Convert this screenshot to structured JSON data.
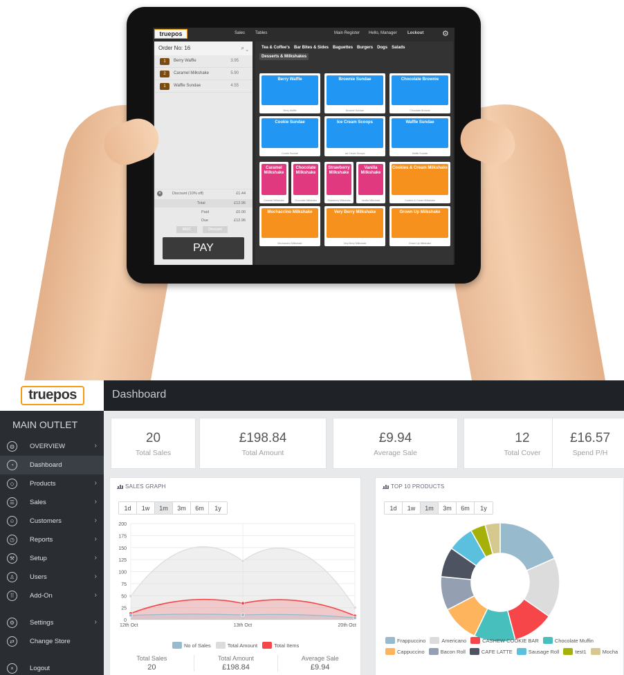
{
  "tablet": {
    "brand": "truepos",
    "top_nav": {
      "sales": "Sales",
      "tables": "Tables",
      "register": "Main Register",
      "user": "Hello, Manager",
      "lockout": "Lockout"
    },
    "order_title": "Order No: 16",
    "order_lines": [
      {
        "qty": "1",
        "name": "Berry Waffle",
        "price": "3.95"
      },
      {
        "qty": "2",
        "name": "Caramel Milkshake",
        "price": "5.90"
      },
      {
        "qty": "1",
        "name": "Waffle Sundae",
        "price": "4.55"
      }
    ],
    "discount_label": "Discount (10% off)",
    "discount_value": "£1.44",
    "total_label": "Total",
    "total_value": "£12.96",
    "paid_label": "Paid",
    "paid_value": "£0.00",
    "due_label": "Due",
    "due_value": "£12.96",
    "misc_label": "MISC",
    "discount_btn": "Discount",
    "pay_label": "PAY",
    "categories": [
      "Tea & Coffee's",
      "Bar Bites & Sides",
      "Baguettes",
      "Burgers",
      "Dogs",
      "Salads",
      "Desserts & Milkshakes"
    ],
    "tiles": [
      {
        "name": "Berry Waffle",
        "sub": "Berry Waffle",
        "color": "blue"
      },
      {
        "name": "Brownie Sundae",
        "sub": "Brownie Sundae",
        "color": "blue"
      },
      {
        "name": "Chocolate Brownie",
        "sub": "Chocolate Brownie",
        "color": "blue"
      },
      {
        "name": "Cookie Sundae",
        "sub": "Cookie Sundae",
        "color": "blue"
      },
      {
        "name": "Ice Cream Scoops",
        "sub": "Ice Cream Scoops",
        "color": "blue"
      },
      {
        "name": "Waffle Sundae",
        "sub": "Waffle Sundae",
        "color": "blue"
      },
      {
        "name": "Caramel Milkshake",
        "sub": "Caramel Milkshake",
        "color": "pink"
      },
      {
        "name": "Chocolate Milkshake",
        "sub": "Chocolate Milkshake",
        "color": "pink"
      },
      {
        "name": "Strawberry Milkshake",
        "sub": "Strawberry Milkshake",
        "color": "pink"
      },
      {
        "name": "Vanilla Milkshake",
        "sub": "Vanilla Milkshake",
        "color": "pink"
      },
      {
        "name": "Cookies & Cream Milkshake",
        "sub": "Cookies & Cream Milkshake",
        "color": "orange"
      },
      {
        "name": "Mochaccino Milkshake",
        "sub": "Mochaccino Milkshake",
        "color": "orange"
      },
      {
        "name": "Very Berry Milkshake",
        "sub": "Very Berry Milkshake",
        "color": "orange"
      },
      {
        "name": "Grown Up Milkshake",
        "sub": "Grown Up Milkshake",
        "color": "orange"
      }
    ]
  },
  "brand": {
    "logo_text": "truepos",
    "accent": "#f39c12"
  },
  "header": {
    "title": "Dashboard"
  },
  "sidebar": {
    "outlet": "MAIN OUTLET",
    "items": [
      {
        "label": "OVERVIEW",
        "icon": "globe-icon",
        "has_chevron": true
      },
      {
        "label": "Dashboard",
        "icon": "speedometer-icon",
        "has_chevron": false,
        "active": true
      },
      {
        "label": "Products",
        "icon": "tag-icon",
        "has_chevron": true
      },
      {
        "label": "Sales",
        "icon": "list-icon",
        "has_chevron": true
      },
      {
        "label": "Customers",
        "icon": "people-icon",
        "has_chevron": true
      },
      {
        "label": "Reports",
        "icon": "clock-icon",
        "has_chevron": true
      },
      {
        "label": "Setup",
        "icon": "wrench-icon",
        "has_chevron": true
      },
      {
        "label": "Users",
        "icon": "user-icon",
        "has_chevron": true
      },
      {
        "label": "Add-On",
        "icon": "grid-icon",
        "has_chevron": true
      },
      {
        "label": "Settings",
        "icon": "gear-icon",
        "has_chevron": true
      },
      {
        "label": "Change Store",
        "icon": "shuffle-icon",
        "has_chevron": false
      },
      {
        "label": "Logout",
        "icon": "close-circle-icon",
        "has_chevron": false
      }
    ]
  },
  "stats": [
    {
      "value": "20",
      "label": "Total Sales"
    },
    {
      "value": "£198.84",
      "label": "Total Amount"
    },
    {
      "value": "£9.94",
      "label": "Average Sale"
    },
    {
      "value": "12",
      "label": "Total Cover"
    },
    {
      "value": "£16.57",
      "label": "Spend P/H"
    }
  ],
  "sales_graph": {
    "heading": "SALES GRAPH",
    "ranges": [
      "1d",
      "1w",
      "1m",
      "3m",
      "6m",
      "1y"
    ],
    "selected_range": "1m",
    "summary": [
      {
        "label": "Total Sales",
        "value": "20"
      },
      {
        "label": "Total Amount",
        "value": "£198.84"
      },
      {
        "label": "Average Sale",
        "value": "£9.94"
      }
    ]
  },
  "top_products": {
    "heading": "TOP 10 PRODUCTS",
    "ranges": [
      "1d",
      "1w",
      "1m",
      "3m",
      "6m",
      "1y"
    ],
    "selected_range": "1m"
  },
  "chart_data": [
    {
      "type": "line",
      "title": "SALES GRAPH",
      "x": [
        "12th Oct",
        "13th Oct",
        "20th Oct"
      ],
      "ylim": [
        0,
        200
      ],
      "yticks": [
        0,
        25,
        50,
        75,
        100,
        125,
        150,
        175,
        200
      ],
      "series": [
        {
          "name": "No of Sales",
          "values": [
            9,
            10,
            4
          ],
          "color": "#97bbcd"
        },
        {
          "name": "Total Amount",
          "values": [
            49,
            122,
            25
          ],
          "color": "#dcdcdc"
        },
        {
          "name": "Total Items",
          "values": [
            13,
            34,
            8
          ],
          "color": "#f7464a"
        }
      ],
      "grid": true,
      "legend": "bottom"
    },
    {
      "type": "pie",
      "title": "TOP 10 PRODUCTS",
      "donut": true,
      "series": [
        {
          "name": "Frappuccino",
          "value": 18,
          "color": "#97bbcd"
        },
        {
          "name": "Americano",
          "value": 16,
          "color": "#dcdcdc"
        },
        {
          "name": "CASHEW COOKIE BAR",
          "value": 11,
          "color": "#f7464a"
        },
        {
          "name": "Chocolate Muffin",
          "value": 11,
          "color": "#46bfbd"
        },
        {
          "name": "Cappuccino",
          "value": 10,
          "color": "#fdb45c"
        },
        {
          "name": "Bacon Roll",
          "value": 9,
          "color": "#949fb1"
        },
        {
          "name": "CAFE LATTE",
          "value": 8,
          "color": "#4d5360"
        },
        {
          "name": "Sausage Roll",
          "value": 7,
          "color": "#5bc0de"
        },
        {
          "name": "test1",
          "value": 4,
          "color": "#a5b10a"
        },
        {
          "name": "Mocha",
          "value": 4,
          "color": "#d5c98f"
        }
      ],
      "legend": "bottom"
    }
  ]
}
